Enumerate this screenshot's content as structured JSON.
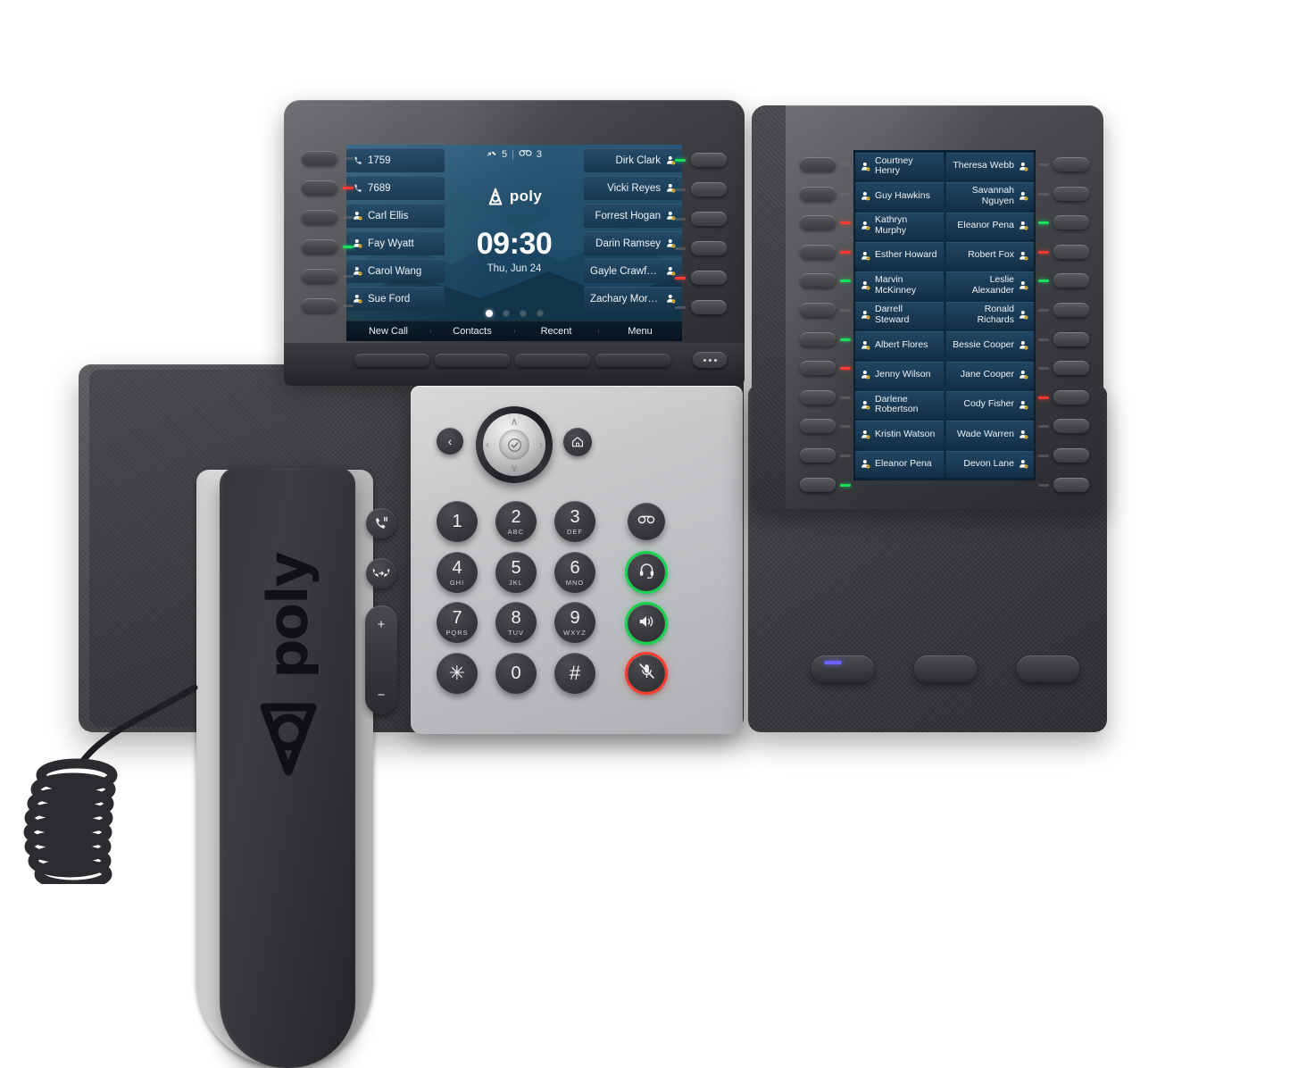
{
  "device": {
    "brand": "poly",
    "handset_logo_text": "poly"
  },
  "main_screen": {
    "status": {
      "missed_calls_icon": "missed-call-icon",
      "missed_calls_count": "5",
      "voicemail_icon": "voicemail-icon",
      "voicemail_count": "3"
    },
    "brand_text": "poly",
    "clock": "09:30",
    "date": "Thu, Jun 24",
    "page_dots": {
      "total": 4,
      "active": 1
    },
    "left_line_keys": [
      {
        "label": "1759",
        "icon": "phone-icon"
      },
      {
        "label": "7689",
        "icon": "phone-icon"
      },
      {
        "label": "Carl Ellis",
        "icon": "contact-icon"
      },
      {
        "label": "Fay Wyatt",
        "icon": "contact-icon"
      },
      {
        "label": "Carol Wang",
        "icon": "contact-icon"
      },
      {
        "label": "Sue Ford",
        "icon": "contact-icon"
      }
    ],
    "right_line_keys": [
      {
        "label": "Dirk Clark",
        "icon": "contact-icon"
      },
      {
        "label": "Vicki Reyes",
        "icon": "contact-icon"
      },
      {
        "label": "Forrest Hogan",
        "icon": "contact-icon"
      },
      {
        "label": "Darin Ramsey",
        "icon": "contact-icon"
      },
      {
        "label": "Gayle Crawford",
        "icon": "contact-icon"
      },
      {
        "label": "Zachary Moreno",
        "icon": "contact-icon"
      }
    ],
    "softkeys": [
      "New Call",
      "Contacts",
      "Recent",
      "Menu"
    ]
  },
  "main_hardkeys": {
    "left_leds": [
      "off",
      "red",
      "off",
      "green",
      "off",
      "off"
    ],
    "right_leds": [
      "green",
      "off",
      "off",
      "off",
      "red",
      "off"
    ],
    "more_button": "more-button"
  },
  "keypad": {
    "keys": [
      {
        "num": "1",
        "sub": ""
      },
      {
        "num": "2",
        "sub": "ABC"
      },
      {
        "num": "3",
        "sub": "DEF"
      },
      {
        "num": "4",
        "sub": "GHI"
      },
      {
        "num": "5",
        "sub": "JKL"
      },
      {
        "num": "6",
        "sub": "MNO"
      },
      {
        "num": "7",
        "sub": "PQRS"
      },
      {
        "num": "8",
        "sub": "TUV"
      },
      {
        "num": "9",
        "sub": "WXYZ"
      },
      {
        "num": "✳",
        "sub": ""
      },
      {
        "num": "0",
        "sub": ""
      },
      {
        "num": "#",
        "sub": ""
      }
    ],
    "function_keys": [
      {
        "name": "voicemail-button",
        "icon": "voicemail-icon",
        "ring": "none"
      },
      {
        "name": "headset-button",
        "icon": "headset-icon",
        "ring": "green"
      },
      {
        "name": "speaker-button",
        "icon": "speaker-icon",
        "ring": "green"
      },
      {
        "name": "mute-button",
        "icon": "mute-icon",
        "ring": "red"
      }
    ],
    "nav": {
      "ok": "ok-checkmark-icon",
      "up": "∧",
      "down": "∨",
      "left": "‹",
      "right": "›",
      "back": "‹",
      "home": "home-icon"
    },
    "side_buttons": [
      {
        "name": "hold-button",
        "icon": "hold-icon"
      },
      {
        "name": "transfer-button",
        "icon": "transfer-icon"
      }
    ],
    "volume": {
      "up": "+",
      "down": "−"
    }
  },
  "expansion_module": {
    "rows": [
      {
        "left": "Courtney Henry",
        "right": "Theresa Webb"
      },
      {
        "left": "Guy Hawkins",
        "right": "Savannah Nguyen"
      },
      {
        "left": "Kathryn Murphy",
        "right": "Eleanor Pena"
      },
      {
        "left": "Esther Howard",
        "right": "Robert Fox"
      },
      {
        "left": "Marvin McKinney",
        "right": "Leslie Alexander"
      },
      {
        "left": "Darrell Steward",
        "right": "Ronald Richards"
      },
      {
        "left": "Albert Flores",
        "right": "Bessie Cooper"
      },
      {
        "left": "Jenny Wilson",
        "right": "Jane Cooper"
      },
      {
        "left": "Darlene Robertson",
        "right": "Cody Fisher"
      },
      {
        "left": "Kristin Watson",
        "right": "Wade Warren"
      },
      {
        "left": "Eleanor Pena",
        "right": "Devon Lane"
      }
    ],
    "left_leds": [
      "off",
      "off",
      "red",
      "red",
      "green",
      "off",
      "green",
      "red",
      "off",
      "off",
      "off",
      "green"
    ],
    "right_leds": [
      "off",
      "off",
      "green",
      "red",
      "green",
      "off",
      "off",
      "off",
      "red",
      "off",
      "off",
      "off"
    ],
    "page_buttons": [
      {
        "name": "page-1-button",
        "led": "blue"
      },
      {
        "name": "page-2-button",
        "led": "off"
      },
      {
        "name": "page-3-button",
        "led": "off"
      }
    ]
  },
  "colors": {
    "led_red": "#ff3b30",
    "led_green": "#19e05a",
    "led_blue": "#6c63ff",
    "screen_blue": "#1d4762",
    "bezel": "#3e4044"
  }
}
